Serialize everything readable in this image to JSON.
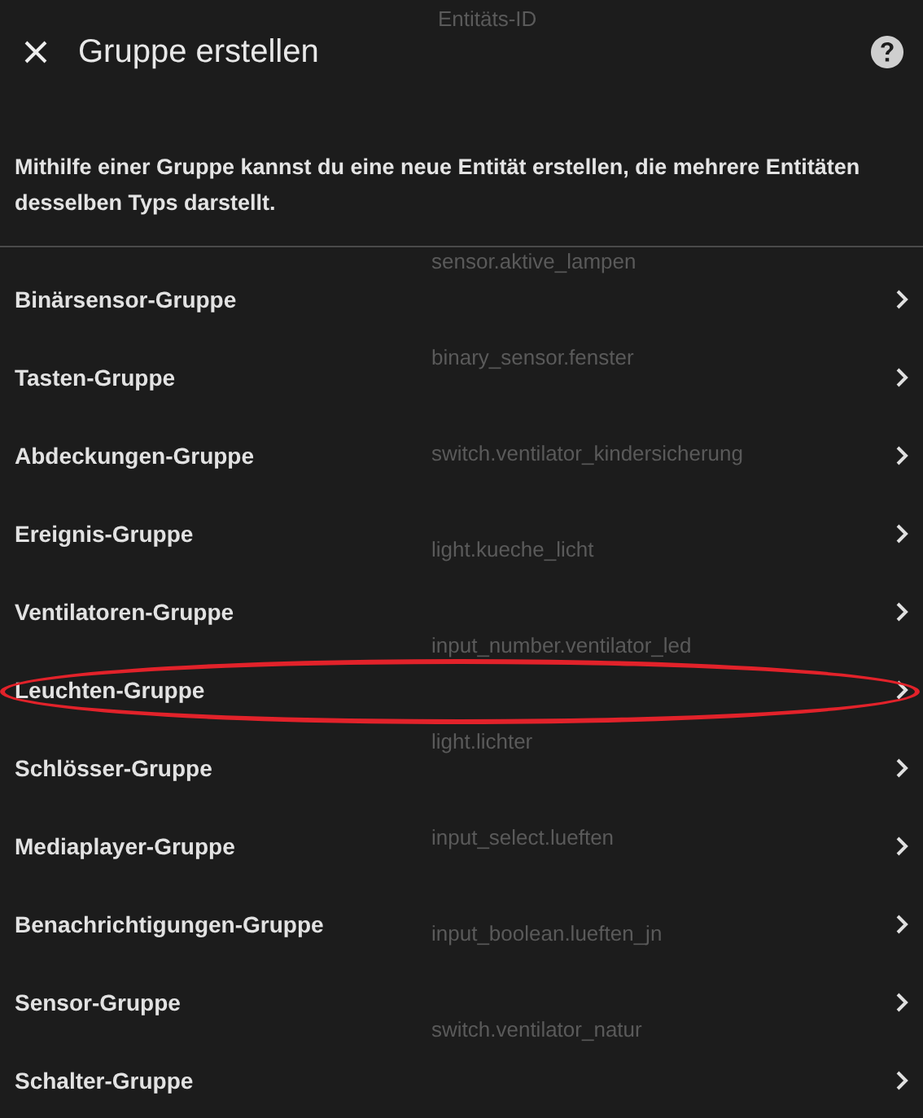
{
  "background": {
    "column_heading": "Entitäts-ID",
    "entity_ids": [
      "sensor.aktive_lampen",
      "binary_sensor.fenster",
      "switch.ventilator_kindersicherung",
      "light.kueche_licht",
      "input_number.ventilator_led",
      "light.lichter",
      "input_select.lueften",
      "input_boolean.lueften_jn",
      "switch.ventilator_natur"
    ]
  },
  "dialog": {
    "title": "Gruppe erstellen",
    "description": "Mithilfe einer Gruppe kannst du eine neue Entität erstellen, die mehrere Entitäten desselben Typs darstellt.",
    "items": [
      {
        "label": "Binärsensor-Gruppe",
        "highlighted": false
      },
      {
        "label": "Tasten-Gruppe",
        "highlighted": false
      },
      {
        "label": "Abdeckungen-Gruppe",
        "highlighted": false
      },
      {
        "label": "Ereignis-Gruppe",
        "highlighted": false
      },
      {
        "label": "Ventilatoren-Gruppe",
        "highlighted": false
      },
      {
        "label": "Leuchten-Gruppe",
        "highlighted": true
      },
      {
        "label": "Schlösser-Gruppe",
        "highlighted": false
      },
      {
        "label": "Mediaplayer-Gruppe",
        "highlighted": false
      },
      {
        "label": "Benachrichtigungen-Gruppe",
        "highlighted": false
      },
      {
        "label": "Sensor-Gruppe",
        "highlighted": false
      },
      {
        "label": "Schalter-Gruppe",
        "highlighted": false
      }
    ]
  }
}
